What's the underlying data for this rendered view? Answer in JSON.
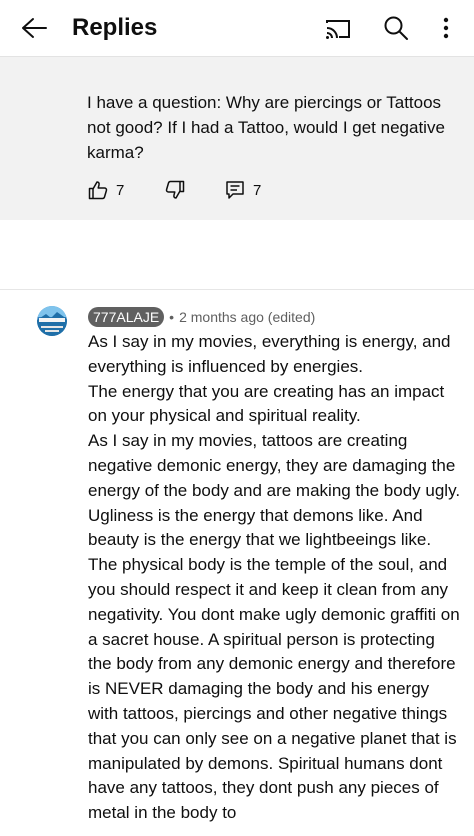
{
  "header": {
    "title": "Replies",
    "back_icon": "arrow-back-icon",
    "cast_icon": "cast-icon",
    "search_icon": "search-icon",
    "more_icon": "more-vert-icon"
  },
  "parent_comment": {
    "text": "I have a question: Why are piercings or Tattoos not good? If I had a Tattoo, would I get negative karma?",
    "like_count": "7",
    "reply_count": "7"
  },
  "reply": {
    "author": "777ALAJE",
    "separator": "•",
    "timestamp": "2 months ago (edited)",
    "paragraphs": [
      "As I say in my movies, everything is energy, and everything is influenced by energies.",
      "The energy that you are creating has an impact on your physical and spiritual reality.",
      "As I say in my movies, tattoos are creating negative demonic energy, they are damaging the energy of the body and are making the body ugly. Ugliness is the energy that demons like. And beauty is the energy that we lightbeeings like. The physical body is the temple of the soul, and you should respect it and keep it clean from any negativity. You dont make ugly demonic graffiti on a sacret house. A spiritual person is protecting the body from any demonic energy and therefore is NEVER damaging the body and his energy with tattoos, piercings and other negative things that you can only see on a negative planet that is manipulated by demons. Spiritual humans dont have any tattoos, they dont push any pieces of metal in the body to"
    ]
  },
  "colors": {
    "chip_bg": "#606060",
    "parent_bg": "#f2f2f2",
    "meta_text": "#606060"
  }
}
